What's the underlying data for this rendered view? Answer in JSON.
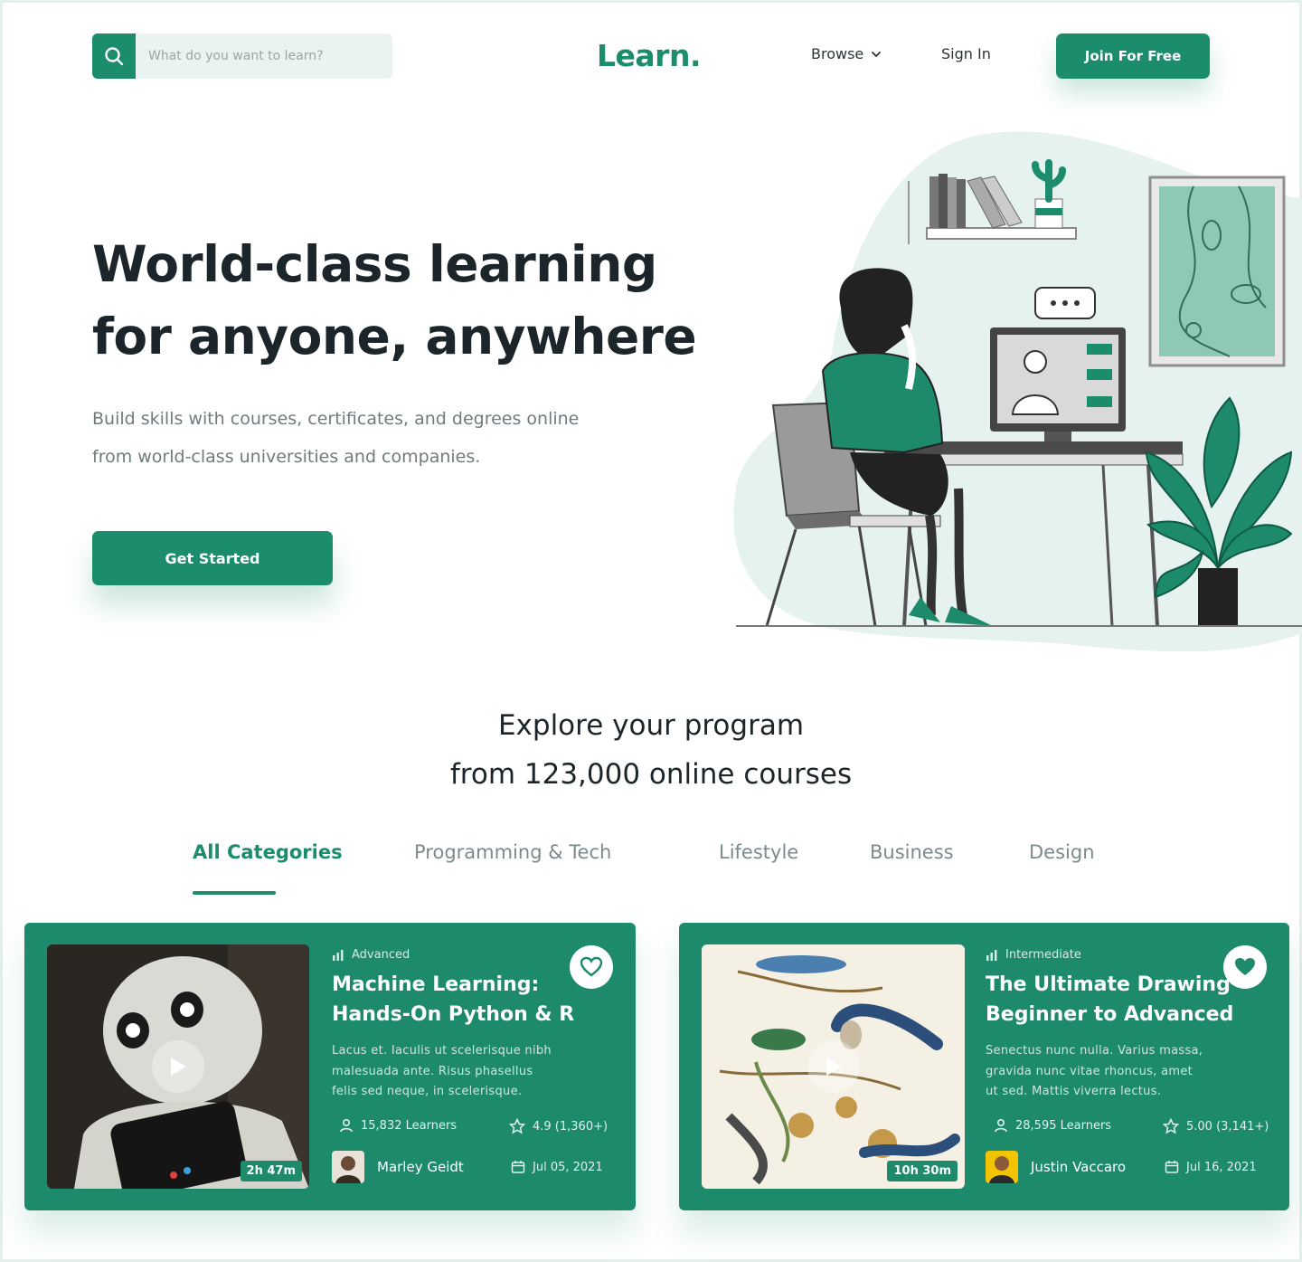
{
  "header": {
    "search_placeholder": "What do you want to learn?",
    "logo": "Learn.",
    "browse_label": "Browse",
    "signin_label": "Sign In",
    "join_label": "Join For Free"
  },
  "hero": {
    "title_line1": "World-class learning",
    "title_line2": "for anyone, anywhere",
    "subtitle_line1": "Build skills with courses, certificates, and degrees online",
    "subtitle_line2": "from world-class universities and companies.",
    "cta_label": "Get Started"
  },
  "explore": {
    "line1": "Explore your program",
    "line2": "from 123,000 online courses"
  },
  "tabs": [
    {
      "label": "All Categories",
      "active": true
    },
    {
      "label": "Programming & Tech",
      "active": false
    },
    {
      "label": "Lifestyle",
      "active": false
    },
    {
      "label": "Business",
      "active": false
    },
    {
      "label": "Design",
      "active": false
    }
  ],
  "courses": [
    {
      "level": "Advanced",
      "title_line1": "Machine Learning:",
      "title_line2": "Hands-On Python & R",
      "desc_line1": "Lacus et. Iaculis ut scelerisque nibh",
      "desc_line2": "malesuada ante. Risus phasellus",
      "desc_line3": "felis sed neque, in scelerisque.",
      "learners": "15,832 Learners",
      "rating": "4.9 (1,360+)",
      "author": "Marley Geidt",
      "date": "Jul 05, 2021",
      "duration": "2h 47m"
    },
    {
      "level": "Intermediate",
      "title_line1": "The Ultimate Drawing",
      "title_line2": "Beginner to Advanced",
      "desc_line1": "Senectus nunc nulla. Varius massa,",
      "desc_line2": "gravida nunc vitae rhoncus, amet",
      "desc_line3": "ut sed. Mattis viverra lectus.",
      "learners": "28,595 Learners",
      "rating": "5.00 (3,141+)",
      "author": "Justin Vaccaro",
      "date": "Jul 16, 2021",
      "duration": "10h 30m"
    }
  ],
  "colors": {
    "accent": "#1b8c6c",
    "heading": "#1c2529",
    "muted": "#6f7b7d"
  },
  "icons": [
    "search-icon",
    "chevron-down-icon",
    "heart-icon",
    "play-icon",
    "level-bars-icon",
    "user-icon",
    "star-icon",
    "calendar-icon"
  ]
}
